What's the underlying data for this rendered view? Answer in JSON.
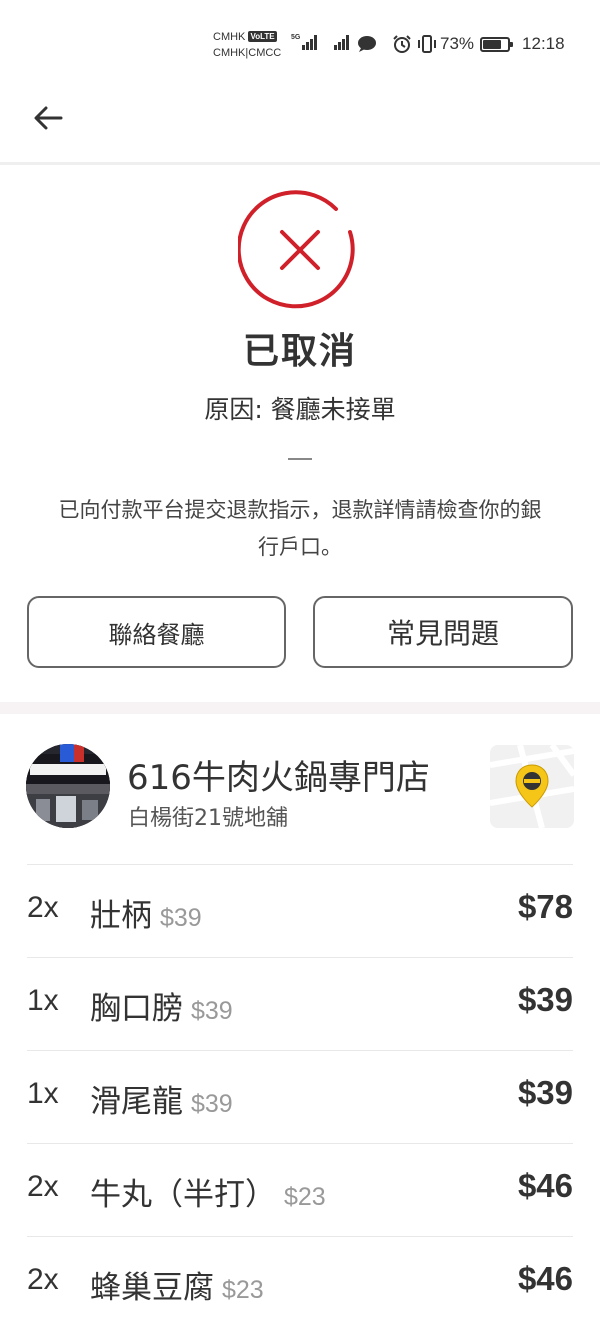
{
  "status_bar": {
    "carrier_line1": "CMHK",
    "volte": "VoLTE",
    "carrier_line2": "CMHK|CMCC",
    "network": "5G",
    "battery_percent": "73%",
    "battery_level": 0.73,
    "time": "12:18"
  },
  "header": {
    "back_icon": "arrow-left-icon"
  },
  "order_status": {
    "status_icon": "cancel-x-circle-icon",
    "accent_color": "#d0202a",
    "title": "已取消",
    "reason": "原因: 餐廳未接單",
    "refund_note": "已向付款平台提交退款指示，退款詳情請檢查你的銀行戶口。"
  },
  "actions": {
    "contact_label": "聯絡餐廳",
    "faq_label": "常見問題"
  },
  "restaurant": {
    "name": "616牛肉火鍋專門店",
    "address": "白楊街21號地舖",
    "map_icon": "map-pin-icon",
    "pin_color": "#f5c518"
  },
  "order_items": [
    {
      "qty": "2x",
      "name": "壯柄",
      "unit_price": "$39",
      "total": "$78"
    },
    {
      "qty": "1x",
      "name": "胸口膀",
      "unit_price": "$39",
      "total": "$39"
    },
    {
      "qty": "1x",
      "name": "滑尾龍",
      "unit_price": "$39",
      "total": "$39"
    },
    {
      "qty": "2x",
      "name": "牛丸（半打）",
      "unit_price": "$23",
      "total": "$46"
    },
    {
      "qty": "2x",
      "name": "蜂巢豆腐",
      "unit_price": "$23",
      "total": "$46"
    }
  ]
}
